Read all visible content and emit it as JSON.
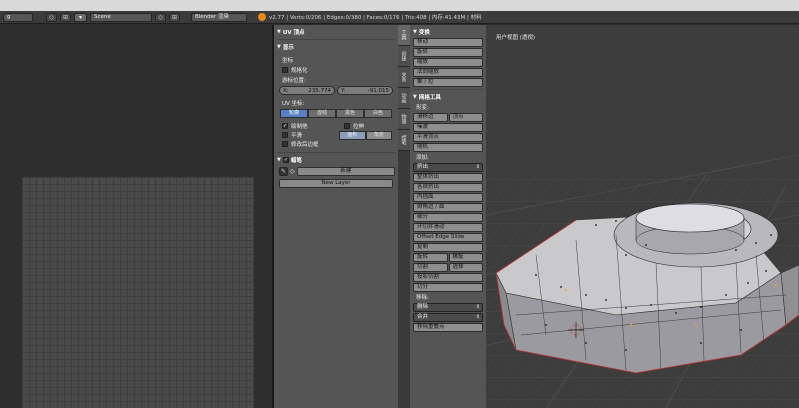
{
  "header": {
    "editor_field": "g",
    "scene_name": "Scene",
    "render_engine": "Blender 渲染",
    "stats": "v2.77 | Verts:0/206 | Edges:0/380 | Faces:0/176 | Tris:408 | 内存:41.43M | 材料"
  },
  "uv_panel": {
    "uv_vertex_header": "UV 顶点",
    "display_header": "显示",
    "coords_label": "坐标",
    "normalized_label": "规格化",
    "cursor_location_label": "游标位置:",
    "x_label": "X:",
    "x_value": "235.774",
    "y_label": "Y:",
    "y_value": "-91.015",
    "uv_coords_label": "UV 坐标:",
    "uv_display_modes": [
      "轮廓",
      "虚线",
      "黑色",
      "白色"
    ],
    "draw_other_objects": "绘制他",
    "smooth": "平滑",
    "modified_edges": "修改后边框",
    "stretch": "拉伸",
    "area_mode": "面积",
    "angle_mode": "角度",
    "grease_pencil_header": "蜡笔",
    "new_button": "新建",
    "new_layer_button": "New Layer"
  },
  "tabs": [
    "工具",
    "创建",
    "关系",
    "动画",
    "物理",
    "蜡笔"
  ],
  "tools": {
    "transform_header": "变换",
    "transform_buttons": [
      "移动",
      "旋转",
      "缩放",
      "法向缩放",
      "推 / 拉"
    ],
    "mesh_tools_header": "网格工具",
    "deform_label": "形变:",
    "slide_edge": "滑移边",
    "vertex": "顶点",
    "noise": "噪波",
    "smooth_vertex": "平滑顶点",
    "randomize": "随机",
    "add_label": "添加:",
    "extrude_dropdown": "挤出",
    "add_buttons": [
      "整体挤出",
      "各自挤出",
      "内插面",
      "倒角边 / 面",
      "细分",
      "环切并滑动",
      "Offset Edge Slide",
      "复制"
    ],
    "spin": "旋转",
    "screw": "螺旋",
    "knife": "切割",
    "select": "选择",
    "knife_project": "投影切割",
    "bisect": "切分",
    "remove_label": "移除:",
    "delete_dropdown": "删除",
    "merge_dropdown": "合并",
    "remove_doubles": "移除重叠点"
  },
  "viewport": {
    "label": "用户视图 (透视)"
  }
}
